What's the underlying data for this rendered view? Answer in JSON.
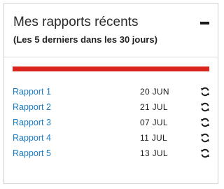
{
  "widget": {
    "title": "Mes rapports récents",
    "subtitle": "(Les 5 derniers dans les 30 jours)",
    "collapse_icon": "minus-icon",
    "colors": {
      "accent": "#d9251d",
      "link": "#1a7cc4"
    }
  },
  "reports": [
    {
      "label": "Rapport 1",
      "date": "20 JUN",
      "icon": "refresh-icon"
    },
    {
      "label": "Rapport 2",
      "date": "21 JUL",
      "icon": "refresh-icon"
    },
    {
      "label": "Rapport 3",
      "date": "07 JUL",
      "icon": "refresh-icon"
    },
    {
      "label": "Rapport 4",
      "date": "11 JUL",
      "icon": "refresh-icon"
    },
    {
      "label": "Rapport 5",
      "date": "13 JUL",
      "icon": "refresh-icon"
    }
  ]
}
